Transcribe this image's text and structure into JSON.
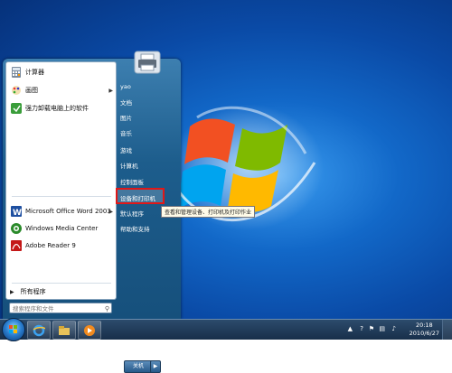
{
  "desktop": {
    "background": "#1268c8"
  },
  "start_menu": {
    "programs": [
      {
        "label": "计算器",
        "icon": "calculator-icon"
      },
      {
        "label": "画图",
        "icon": "paint-icon",
        "has_submenu": true
      },
      {
        "label": "强力卸载电脑上的软件",
        "icon": "uninstall-icon"
      },
      {
        "label": "Microsoft Office Word 2003",
        "icon": "word-icon",
        "has_submenu": true
      },
      {
        "label": "Windows Media Center",
        "icon": "media-center-icon"
      },
      {
        "label": "Adobe Reader 9",
        "icon": "adobe-reader-icon"
      }
    ],
    "all_programs": "所有程序",
    "search_placeholder": "搜索程序和文件",
    "right_items": [
      "yao",
      "文档",
      "图片",
      "音乐",
      "游戏",
      "计算机",
      "控制面板",
      "设备和打印机",
      "默认程序",
      "帮助和支持"
    ],
    "highlighted_item": "设备和打印机",
    "tooltip": "查看和管理设备、打印机及打印作业",
    "shutdown_label": "关机"
  },
  "taskbar": {
    "time": "20:18",
    "date": "2010/6/27",
    "pinned": [
      "internet-explorer-icon",
      "windows-explorer-icon",
      "media-player-icon"
    ]
  },
  "colors": {
    "highlight_border": "#e01818",
    "menu_blue": "#1d5d8c",
    "taskbar": "#182f4a"
  }
}
